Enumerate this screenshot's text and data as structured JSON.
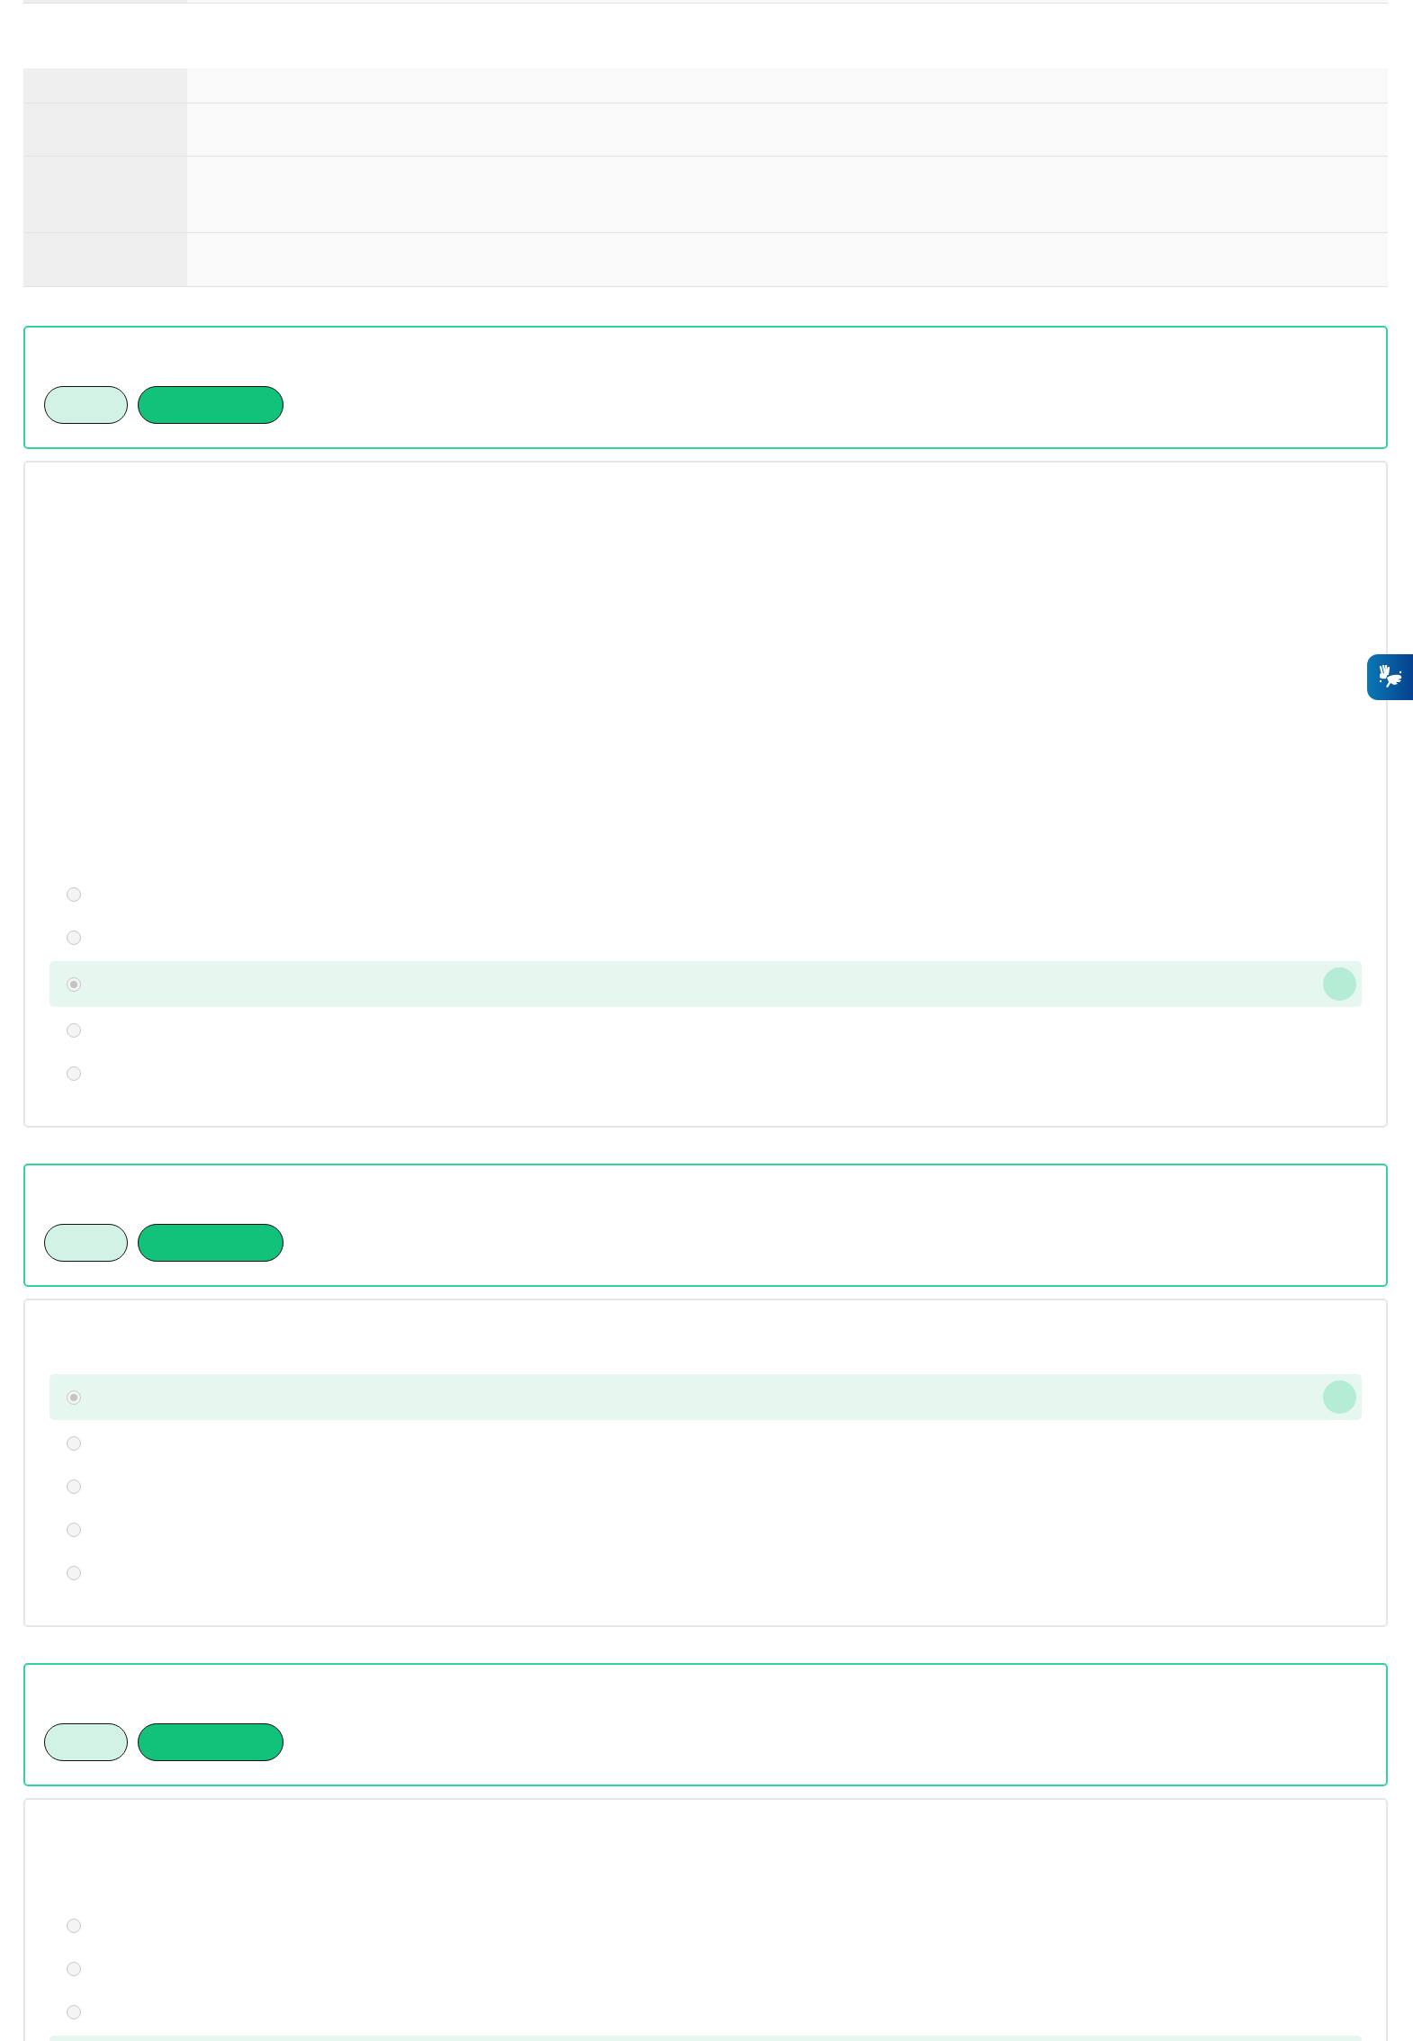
{
  "top_table": {
    "rows": [
      {
        "cut_off": true
      }
    ]
  },
  "info_table": {
    "rows": [
      {
        "kind": "short"
      },
      {
        "kind": "medium"
      },
      {
        "kind": "tall"
      },
      {
        "kind": "medium"
      }
    ]
  },
  "questions": [
    {
      "kind": "long",
      "options": [
        {
          "selected": false
        },
        {
          "selected": false
        },
        {
          "selected": true
        },
        {
          "selected": false
        },
        {
          "selected": false
        }
      ]
    },
    {
      "kind": "short",
      "options": [
        {
          "selected": true
        },
        {
          "selected": false
        },
        {
          "selected": false
        },
        {
          "selected": false
        },
        {
          "selected": false
        }
      ]
    },
    {
      "kind": "medium",
      "options": [
        {
          "selected": false,
          "cut_off": false
        },
        {
          "selected": false,
          "cut_off": false
        },
        {
          "selected": false,
          "cut_off": false
        },
        {
          "selected": true,
          "cut_off": true
        }
      ]
    }
  ],
  "accessibility_button": {
    "kind": "sign-language"
  }
}
